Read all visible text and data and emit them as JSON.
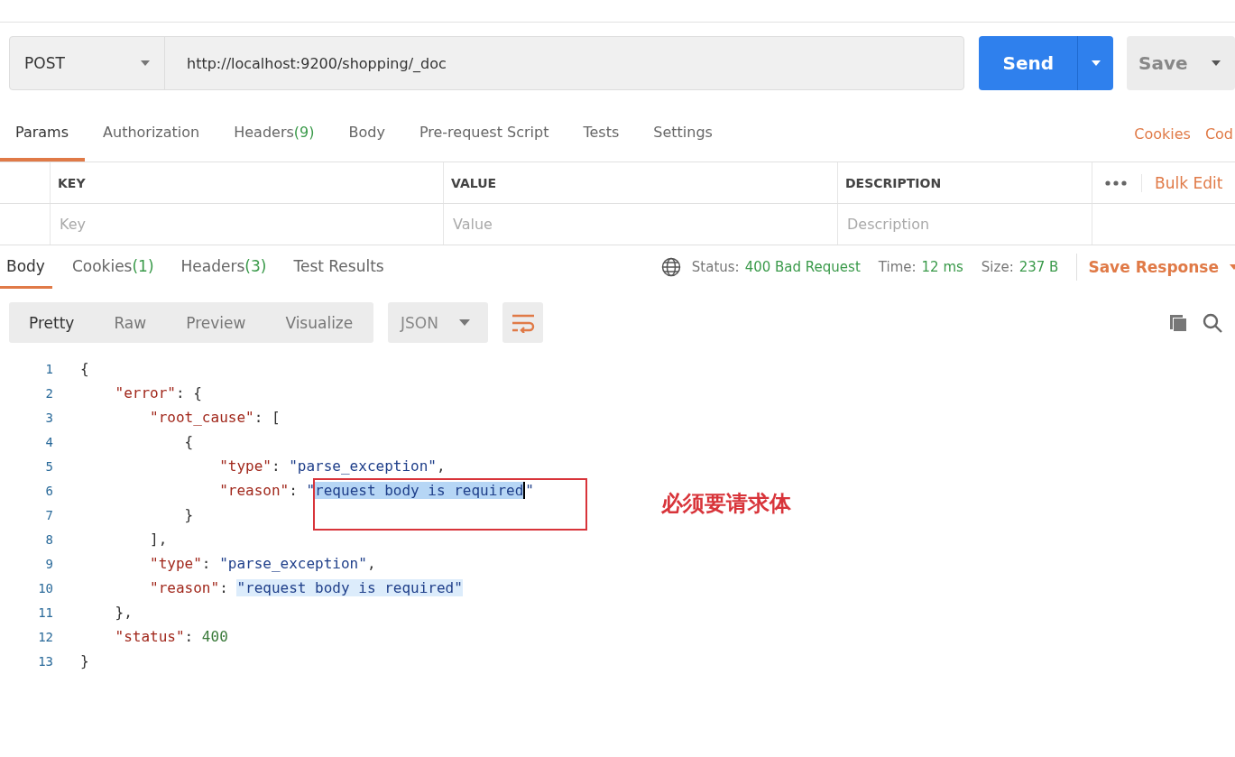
{
  "request": {
    "method": "POST",
    "url": "http://localhost:9200/shopping/_doc",
    "send": "Send",
    "save": "Save"
  },
  "request_tabs": [
    {
      "label": "Params",
      "selected": true
    },
    {
      "label": "Authorization",
      "selected": false
    },
    {
      "label": "Headers",
      "count": "(9)",
      "selected": false
    },
    {
      "label": "Body",
      "selected": false
    },
    {
      "label": "Pre-request Script",
      "selected": false
    },
    {
      "label": "Tests",
      "selected": false
    },
    {
      "label": "Settings",
      "selected": false
    }
  ],
  "request_links": [
    "Cookies",
    "Cod"
  ],
  "params_table": {
    "columns": [
      "KEY",
      "VALUE",
      "DESCRIPTION"
    ],
    "bulk_edit": "Bulk Edit",
    "placeholders": [
      "Key",
      "Value",
      "Description"
    ]
  },
  "response_tabs": [
    {
      "label": "Body",
      "selected": true
    },
    {
      "label": "Cookies",
      "count": "(1)",
      "selected": false
    },
    {
      "label": "Headers",
      "count": "(3)",
      "selected": false
    },
    {
      "label": "Test Results",
      "selected": false
    }
  ],
  "response_meta": [
    {
      "label": "Status:",
      "value": "400 Bad Request"
    },
    {
      "label": "Time:",
      "value": "12 ms"
    },
    {
      "label": "Size:",
      "value": "237 B"
    }
  ],
  "save_response": "Save Response",
  "view_modes": [
    {
      "label": "Pretty",
      "selected": true
    },
    {
      "label": "Raw",
      "selected": false
    },
    {
      "label": "Preview",
      "selected": false
    },
    {
      "label": "Visualize",
      "selected": false
    }
  ],
  "format": "JSON",
  "code_lines": [
    {
      "number": "1",
      "tokens": [
        {
          "text": "{",
          "kind": "punct"
        }
      ]
    },
    {
      "number": "2",
      "tokens": [
        {
          "text": "    \"error\"",
          "kind": "key"
        },
        {
          "text": ": {",
          "kind": "punct"
        }
      ]
    },
    {
      "number": "3",
      "tokens": [
        {
          "text": "        \"root_cause\"",
          "kind": "key"
        },
        {
          "text": ": [",
          "kind": "punct"
        }
      ]
    },
    {
      "number": "4",
      "tokens": [
        {
          "text": "            {",
          "kind": "punct"
        }
      ]
    },
    {
      "number": "5",
      "tokens": [
        {
          "text": "                \"type\"",
          "kind": "key"
        },
        {
          "text": ": ",
          "kind": "punct"
        },
        {
          "text": "\"parse_exception\"",
          "kind": "string"
        },
        {
          "text": ",",
          "kind": "punct"
        }
      ]
    },
    {
      "number": "6",
      "tokens": [
        {
          "text": "                \"reason\"",
          "kind": "key"
        },
        {
          "text": ": ",
          "kind": "punct"
        },
        {
          "text": "\"",
          "kind": "string"
        },
        {
          "text": "request body is required",
          "kind": "selection"
        },
        {
          "text": "\"",
          "kind": "string"
        }
      ]
    },
    {
      "number": "7",
      "tokens": [
        {
          "text": "            }",
          "kind": "punct"
        }
      ]
    },
    {
      "number": "8",
      "tokens": [
        {
          "text": "        ],",
          "kind": "punct"
        }
      ]
    },
    {
      "number": "9",
      "tokens": [
        {
          "text": "        \"type\"",
          "kind": "key"
        },
        {
          "text": ": ",
          "kind": "punct"
        },
        {
          "text": "\"parse_exception\"",
          "kind": "string"
        },
        {
          "text": ",",
          "kind": "punct"
        }
      ]
    },
    {
      "number": "10",
      "tokens": [
        {
          "text": "        \"reason\"",
          "kind": "key"
        },
        {
          "text": ": ",
          "kind": "punct"
        },
        {
          "text": "\"request body is required\"",
          "kind": "match"
        }
      ]
    },
    {
      "number": "11",
      "tokens": [
        {
          "text": "    },",
          "kind": "punct"
        }
      ]
    },
    {
      "number": "12",
      "tokens": [
        {
          "text": "    \"status\"",
          "kind": "key"
        },
        {
          "text": ": ",
          "kind": "punct"
        },
        {
          "text": "400",
          "kind": "number"
        }
      ]
    },
    {
      "number": "13",
      "tokens": [
        {
          "text": "}",
          "kind": "punct"
        }
      ]
    }
  ],
  "annotation": "必须要请求体"
}
